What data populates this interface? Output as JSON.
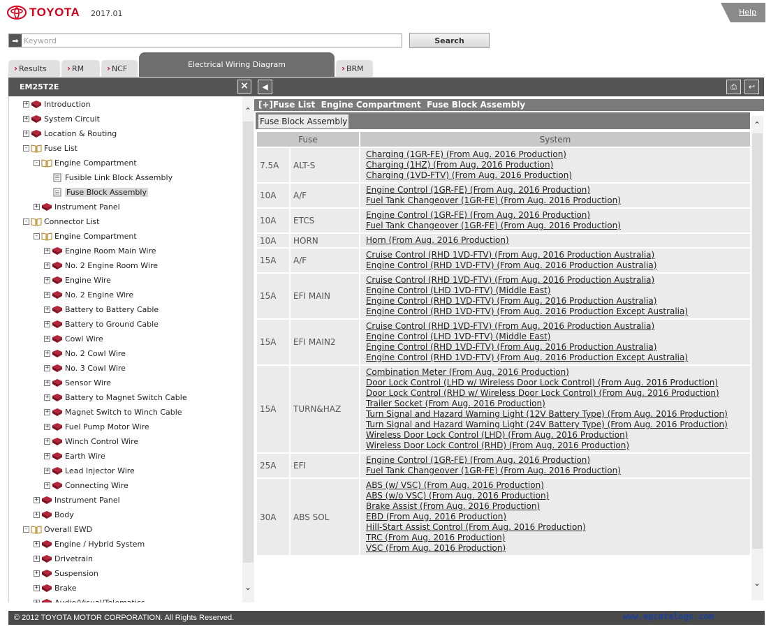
{
  "header": {
    "brand": "TOYOTA",
    "version": "2017.01",
    "help": "Help"
  },
  "search": {
    "placeholder": "Keyword",
    "button": "Search"
  },
  "tabs": [
    "Results",
    "RM",
    "NCF",
    "Electrical Wiring Diagram",
    "BRM"
  ],
  "active_tab": "Electrical Wiring Diagram",
  "left_panel": {
    "title": "EM25T2E",
    "tree": [
      {
        "label": "Introduction",
        "level": 0,
        "exp": "+",
        "icon": "closed-book-icon"
      },
      {
        "label": "System Circuit",
        "level": 0,
        "exp": "+",
        "icon": "closed-book-icon"
      },
      {
        "label": "Location & Routing",
        "level": 0,
        "exp": "+",
        "icon": "closed-book-icon"
      },
      {
        "label": "Fuse List",
        "level": 0,
        "exp": "-",
        "icon": "open-book-icon"
      },
      {
        "label": "Engine Compartment",
        "level": 1,
        "exp": "-",
        "icon": "open-book-icon"
      },
      {
        "label": "Fusible Link Block Assembly",
        "level": 2,
        "exp": "",
        "icon": "document-icon"
      },
      {
        "label": "Fuse Block Assembly",
        "level": 2,
        "exp": "",
        "icon": "document-icon",
        "selected": true
      },
      {
        "label": "Instrument Panel",
        "level": 1,
        "exp": "+",
        "icon": "closed-book-icon"
      },
      {
        "label": "Connector List",
        "level": 0,
        "exp": "-",
        "icon": "open-book-icon"
      },
      {
        "label": "Engine Compartment",
        "level": 1,
        "exp": "-",
        "icon": "open-book-icon"
      },
      {
        "label": "Engine Room Main Wire",
        "level": 2,
        "exp": "+",
        "icon": "closed-book-icon"
      },
      {
        "label": "No. 2 Engine Room Wire",
        "level": 2,
        "exp": "+",
        "icon": "closed-book-icon"
      },
      {
        "label": "Engine Wire",
        "level": 2,
        "exp": "+",
        "icon": "closed-book-icon"
      },
      {
        "label": "No. 2 Engine Wire",
        "level": 2,
        "exp": "+",
        "icon": "closed-book-icon"
      },
      {
        "label": "Battery to Battery Cable",
        "level": 2,
        "exp": "+",
        "icon": "closed-book-icon"
      },
      {
        "label": "Battery to Ground Cable",
        "level": 2,
        "exp": "+",
        "icon": "closed-book-icon"
      },
      {
        "label": "Cowl Wire",
        "level": 2,
        "exp": "+",
        "icon": "closed-book-icon"
      },
      {
        "label": "No. 2 Cowl Wire",
        "level": 2,
        "exp": "+",
        "icon": "closed-book-icon"
      },
      {
        "label": "No. 3 Cowl Wire",
        "level": 2,
        "exp": "+",
        "icon": "closed-book-icon"
      },
      {
        "label": "Sensor Wire",
        "level": 2,
        "exp": "+",
        "icon": "closed-book-icon"
      },
      {
        "label": "Battery to Magnet Switch Cable",
        "level": 2,
        "exp": "+",
        "icon": "closed-book-icon"
      },
      {
        "label": "Magnet Switch to Winch Cable",
        "level": 2,
        "exp": "+",
        "icon": "closed-book-icon"
      },
      {
        "label": "Fuel Pump Motor Wire",
        "level": 2,
        "exp": "+",
        "icon": "closed-book-icon"
      },
      {
        "label": "Winch Control Wire",
        "level": 2,
        "exp": "+",
        "icon": "closed-book-icon"
      },
      {
        "label": "Earth Wire",
        "level": 2,
        "exp": "+",
        "icon": "closed-book-icon"
      },
      {
        "label": "Lead Injector Wire",
        "level": 2,
        "exp": "+",
        "icon": "closed-book-icon"
      },
      {
        "label": "Connecting Wire",
        "level": 2,
        "exp": "+",
        "icon": "closed-book-icon"
      },
      {
        "label": "Instrument Panel",
        "level": 1,
        "exp": "+",
        "icon": "closed-book-icon"
      },
      {
        "label": "Body",
        "level": 1,
        "exp": "+",
        "icon": "closed-book-icon"
      },
      {
        "label": "Overall EWD",
        "level": 0,
        "exp": "-",
        "icon": "open-book-icon"
      },
      {
        "label": "Engine / Hybrid System",
        "level": 1,
        "exp": "+",
        "icon": "closed-book-icon"
      },
      {
        "label": "Drivetrain",
        "level": 1,
        "exp": "+",
        "icon": "closed-book-icon"
      },
      {
        "label": "Suspension",
        "level": 1,
        "exp": "+",
        "icon": "closed-book-icon"
      },
      {
        "label": "Brake",
        "level": 1,
        "exp": "+",
        "icon": "closed-book-icon"
      },
      {
        "label": "Audio/Visual/Telematics",
        "level": 1,
        "exp": "+",
        "icon": "closed-book-icon"
      }
    ]
  },
  "right_panel": {
    "breadcrumb": "[+]Fuse List  Engine Compartment  Fuse Block Assembly",
    "section_label": "Fuse Block Assembly",
    "columns": [
      "Fuse",
      "System"
    ],
    "rows": [
      {
        "amp": "7.5A",
        "name": "ALT-S",
        "systems": [
          "Charging (1GR-FE) (From Aug. 2016 Production)",
          "Charging (1HZ) (From Aug. 2016 Production)",
          "Charging (1VD-FTV) (From Aug. 2016 Production)"
        ]
      },
      {
        "amp": "10A",
        "name": "A/F",
        "systems": [
          "Engine Control (1GR-FE) (From Aug. 2016 Production)",
          "Fuel Tank Changeover (1GR-FE) (From Aug. 2016 Production)"
        ]
      },
      {
        "amp": "10A",
        "name": "ETCS",
        "systems": [
          "Engine Control (1GR-FE) (From Aug. 2016 Production)",
          "Fuel Tank Changeover (1GR-FE) (From Aug. 2016 Production)"
        ]
      },
      {
        "amp": "10A",
        "name": "HORN",
        "systems": [
          "Horn (From Aug. 2016 Production)"
        ]
      },
      {
        "amp": "15A",
        "name": "A/F",
        "systems": [
          "Cruise Control (RHD 1VD-FTV) (From Aug. 2016 Production Australia)",
          "Engine Control (RHD 1VD-FTV) (From Aug. 2016 Production Australia)"
        ]
      },
      {
        "amp": "15A",
        "name": "EFI MAIN",
        "systems": [
          "Cruise Control (RHD 1VD-FTV) (From Aug. 2016 Production Australia)",
          "Engine Control (LHD 1VD-FTV) (Middle East)",
          "Engine Control (RHD 1VD-FTV) (From Aug. 2016 Production Australia)",
          "Engine Control (RHD 1VD-FTV) (From Aug. 2016 Production Except Australia)"
        ]
      },
      {
        "amp": "15A",
        "name": "EFI MAIN2",
        "systems": [
          "Cruise Control (RHD 1VD-FTV) (From Aug. 2016 Production Australia)",
          "Engine Control (LHD 1VD-FTV) (Middle East)",
          "Engine Control (RHD 1VD-FTV) (From Aug. 2016 Production Australia)",
          "Engine Control (RHD 1VD-FTV) (From Aug. 2016 Production Except Australia)"
        ]
      },
      {
        "amp": "15A",
        "name": "TURN&HAZ",
        "systems": [
          "Combination Meter (From Aug. 2016 Production)",
          "Door Lock Control (LHD w/ Wireless Door Lock Control) (From Aug. 2016 Production)",
          "Door Lock Control (RHD w/ Wireless Door Lock Control) (From Aug. 2016 Production)",
          "Trailer Socket (From Aug. 2016 Production)",
          "Turn Signal and Hazard Warning Light (12V Battery Type) (From Aug. 2016 Production)",
          "Turn Signal and Hazard Warning Light (24V Battery Type) (From Aug. 2016 Production)",
          "Wireless Door Lock Control (LHD) (From Aug. 2016 Production)",
          "Wireless Door Lock Control (RHD) (From Aug. 2016 Production)"
        ]
      },
      {
        "amp": "25A",
        "name": "EFI",
        "systems": [
          "Engine Control (1GR-FE) (From Aug. 2016 Production)",
          "Fuel Tank Changeover (1GR-FE) (From Aug. 2016 Production)"
        ]
      },
      {
        "amp": "30A",
        "name": "ABS SOL",
        "systems": [
          "ABS (w/ VSC) (From Aug. 2016 Production)",
          "ABS (w/o VSC) (From Aug. 2016 Production)",
          "Brake Assist (From Aug. 2016 Production)",
          "EBD (From Aug. 2016 Production)",
          "Hill-Start Assist Control (From Aug. 2016 Production)",
          "TRC (From Aug. 2016 Production)",
          "VSC (From Aug. 2016 Production)"
        ]
      }
    ]
  },
  "footer": {
    "copyright": "© 2012 TOYOTA MOTOR CORPORATION. All Rights Reserved.",
    "watermark": "www.epcatalogs.com"
  },
  "colors": {
    "brand_red": "#d0021b",
    "bar_dark": "#555555",
    "row_bg": "#ebebeb"
  }
}
